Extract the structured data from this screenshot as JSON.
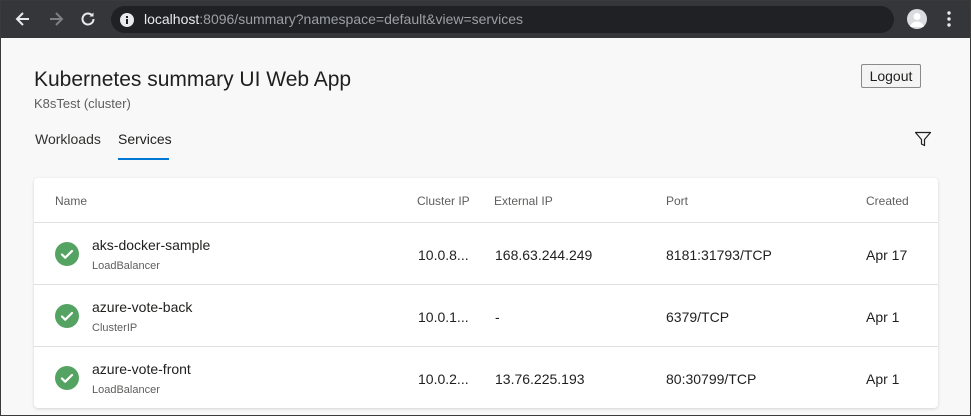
{
  "browser": {
    "url_host": "localhost",
    "url_rest": ":8096/summary?namespace=default&view=services"
  },
  "header": {
    "title": "Kubernetes summary UI Web App",
    "subtitle": "K8sTest (cluster)",
    "logout_label": "Logout"
  },
  "tabs": [
    {
      "label": "Workloads",
      "active": false
    },
    {
      "label": "Services",
      "active": true
    }
  ],
  "table": {
    "columns": [
      "Name",
      "Cluster IP",
      "External IP",
      "Port",
      "Created"
    ],
    "rows": [
      {
        "name": "aks-docker-sample",
        "type": "LoadBalancer",
        "cluster_ip": "10.0.8...",
        "external_ip": "168.63.244.249",
        "port": "8181:31793/TCP",
        "created": "Apr 17",
        "status": "ok"
      },
      {
        "name": "azure-vote-back",
        "type": "ClusterIP",
        "cluster_ip": "10.0.1...",
        "external_ip": "-",
        "port": "6379/TCP",
        "created": "Apr 1",
        "status": "ok"
      },
      {
        "name": "azure-vote-front",
        "type": "LoadBalancer",
        "cluster_ip": "10.0.2...",
        "external_ip": "13.76.225.193",
        "port": "80:30799/TCP",
        "created": "Apr 1",
        "status": "ok"
      }
    ]
  },
  "colors": {
    "accent": "#0078d4",
    "status_ok": "#55a362"
  },
  "icons": {
    "back": "arrow-left-icon",
    "forward": "arrow-right-icon",
    "reload": "reload-icon",
    "site_info": "info-icon",
    "profile": "profile-icon",
    "menu": "more-vertical-icon",
    "filter": "filter-icon",
    "status": "check-circle-icon"
  }
}
